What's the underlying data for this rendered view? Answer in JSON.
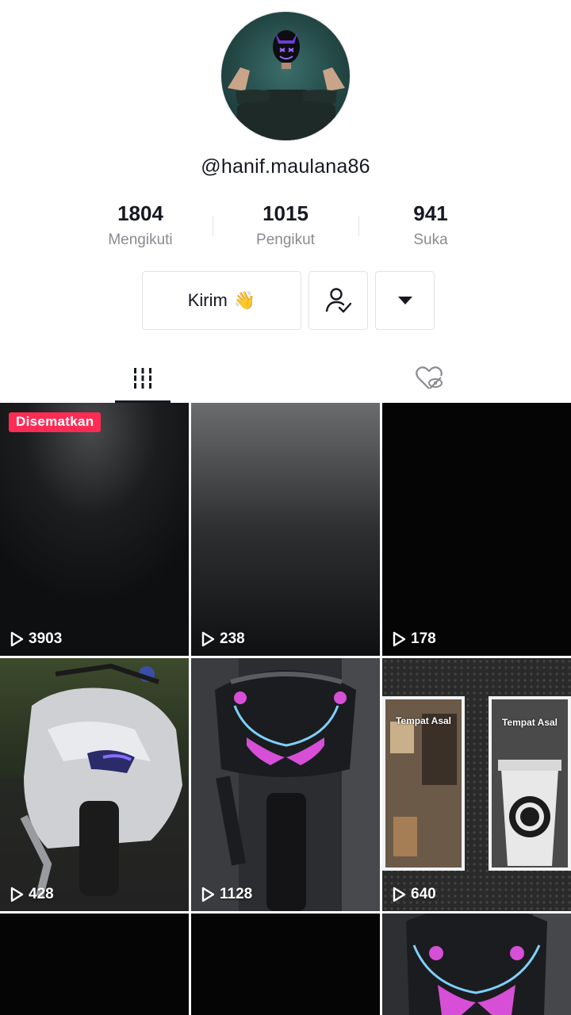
{
  "profile": {
    "username": "@hanif.maulana86",
    "stats": [
      {
        "value": "1804",
        "label": "Mengikuti"
      },
      {
        "value": "1015",
        "label": "Pengikut"
      },
      {
        "value": "941",
        "label": "Suka"
      }
    ],
    "send_button_label": "Kirim",
    "send_button_emoji": "👋"
  },
  "tabs": [
    {
      "icon": "grid-icon",
      "active": true
    },
    {
      "icon": "liked-hidden-icon",
      "active": false
    }
  ],
  "videos": [
    {
      "views": "3903",
      "pinned_label": "Disematkan"
    },
    {
      "views": "238"
    },
    {
      "views": "178"
    },
    {
      "views": "428"
    },
    {
      "views": "1128"
    },
    {
      "views": "640",
      "overlay_text": [
        "Tempat Asal",
        "Tempat Asal"
      ]
    },
    {
      "views": ""
    },
    {
      "views": ""
    },
    {
      "views": ""
    }
  ],
  "colors": {
    "accent": "#fe2c55",
    "text_primary": "#161823",
    "text_secondary": "#8a8b91"
  }
}
